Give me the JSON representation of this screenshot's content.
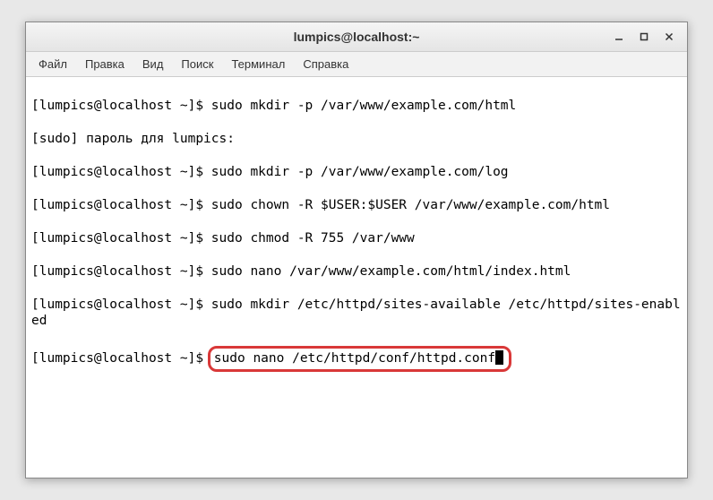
{
  "window": {
    "title": "lumpics@localhost:~"
  },
  "menu": {
    "items": [
      "Файл",
      "Правка",
      "Вид",
      "Поиск",
      "Терминал",
      "Справка"
    ]
  },
  "terminal": {
    "prompt": "[lumpics@localhost ~]$ ",
    "lines": [
      {
        "prompt": "[lumpics@localhost ~]$ ",
        "cmd": "sudo mkdir -p /var/www/example.com/html"
      },
      {
        "prompt": "",
        "cmd": "[sudo] пароль для lumpics:"
      },
      {
        "prompt": "[lumpics@localhost ~]$ ",
        "cmd": "sudo mkdir -p /var/www/example.com/log"
      },
      {
        "prompt": "[lumpics@localhost ~]$ ",
        "cmd": "sudo chown -R $USER:$USER /var/www/example.com/html"
      },
      {
        "prompt": "[lumpics@localhost ~]$ ",
        "cmd": "sudo chmod -R 755 /var/www"
      },
      {
        "prompt": "[lumpics@localhost ~]$ ",
        "cmd": "sudo nano /var/www/example.com/html/index.html"
      },
      {
        "prompt": "[lumpics@localhost ~]$ ",
        "cmd": "sudo mkdir /etc/httpd/sites-available /etc/httpd/sites-enabled"
      }
    ],
    "current": {
      "prompt": "[lumpics@localhost ~]$ ",
      "cmd": "sudo nano /etc/httpd/conf/httpd.conf"
    }
  }
}
